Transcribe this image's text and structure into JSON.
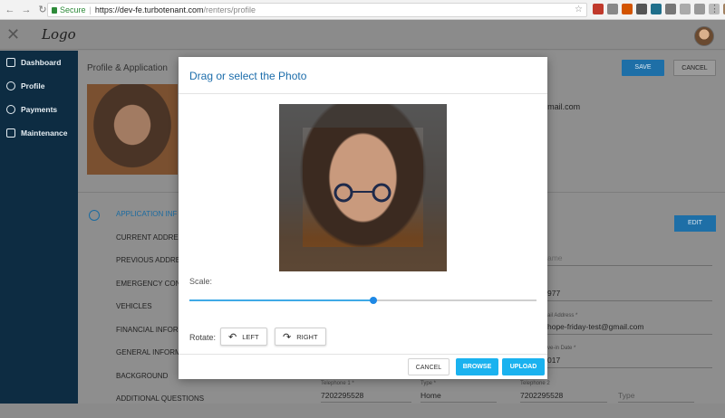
{
  "browser": {
    "secure_label": "Secure",
    "url_host": "https://dev-fe.turbotenant.com",
    "url_path": "/renters/profile"
  },
  "header": {
    "logo_text": "Logo"
  },
  "sidebar": {
    "items": [
      {
        "label": "Dashboard",
        "icon": "home-icon"
      },
      {
        "label": "Profile",
        "icon": "user-icon"
      },
      {
        "label": "Payments",
        "icon": "dollar-icon"
      },
      {
        "label": "Maintenance",
        "icon": "wrench-icon"
      }
    ]
  },
  "background": {
    "section_title": "Profile & Application",
    "save_label": "SAVE",
    "cancel_label": "CANCEL",
    "email_partial": "@gmail.com",
    "edit_label": "EDIT",
    "application_items": [
      "APPLICATION INF",
      "CURRENT ADDRES",
      "PREVIOUS ADDRE",
      "EMERGENCY CON",
      "VEHICLES",
      "FINANCIAL INFOR",
      "GENERAL INFORM",
      "BACKGROUND",
      "ADDITIONAL QUESTIONS"
    ],
    "fields": {
      "name_placeholder": "ame",
      "phone_partial": "977",
      "email_label": "ail Address *",
      "email_value": "hope-friday-test@gmail.com",
      "date_label": "ve-in Date *",
      "date_value": "017",
      "tel1_label": "Telephone 1 *",
      "tel1_value": "7202295528",
      "type1_label": "Type *",
      "type1_value": "Home",
      "tel2_label": "Telephone 2",
      "tel2_value": "7202295528",
      "type2_value": "Type"
    }
  },
  "modal": {
    "title": "Drag or select the Photo",
    "scale_label": "Scale:",
    "scale_value": 0.53,
    "rotate_label": "Rotate:",
    "rotate_left": "LEFT",
    "rotate_right": "RIGHT",
    "cancel": "CANCEL",
    "browse": "BROWSE",
    "upload": "UPLOAD"
  },
  "colors": {
    "accent": "#1ab2ef",
    "title_blue": "#1c6dab",
    "sidebar_bg": "#0d2c42"
  }
}
